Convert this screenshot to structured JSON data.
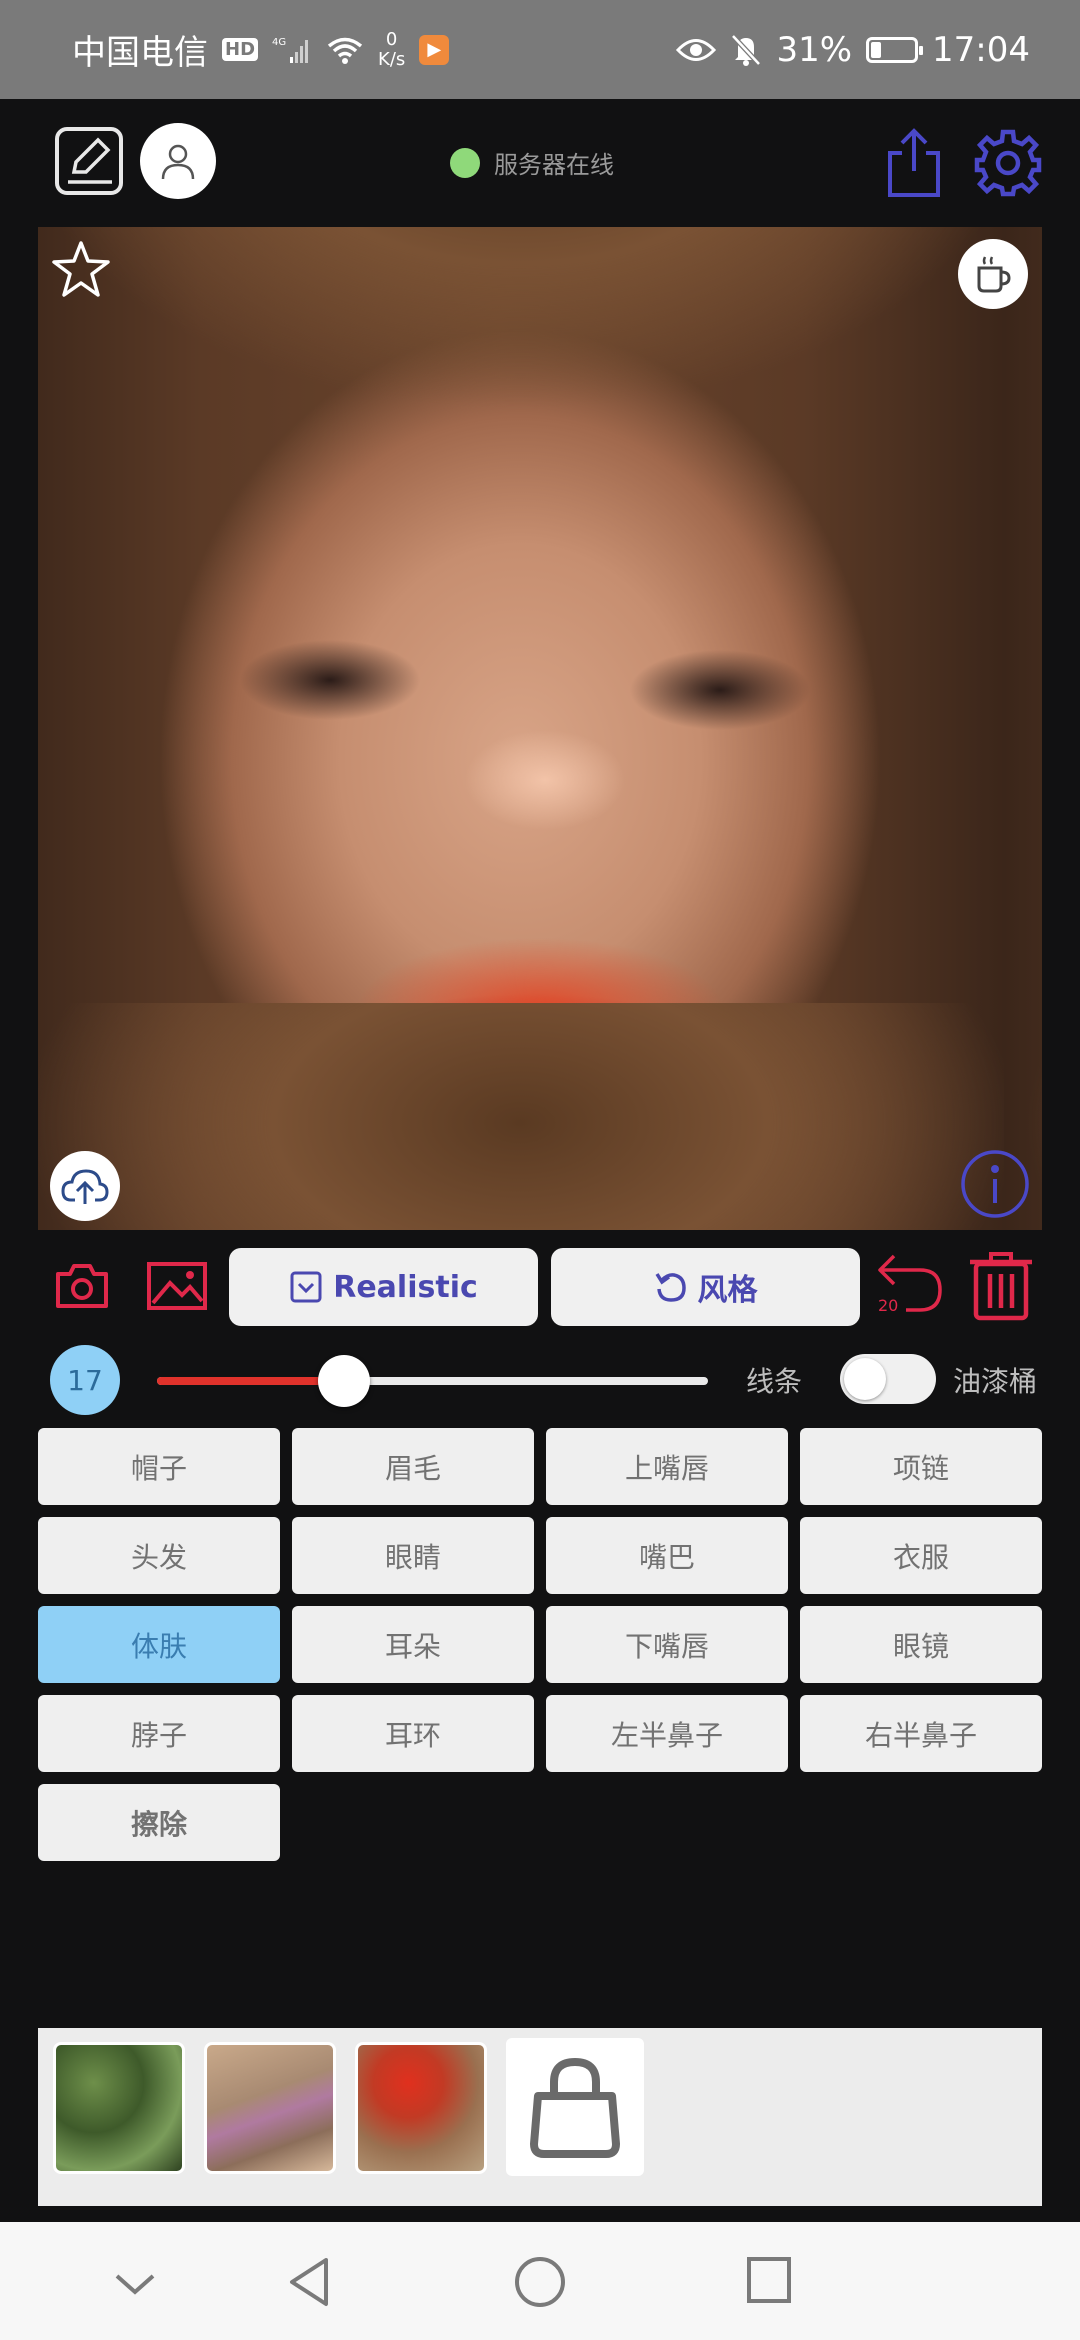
{
  "status_bar": {
    "carrier": "中国电信",
    "hd": "HD",
    "network": "4G",
    "speed_value": "0",
    "speed_unit": "K/s",
    "battery": "31%",
    "battery_level": 0.31,
    "time": "17:04"
  },
  "toolbar": {
    "server_status": "服务器在线",
    "server_dot_color": "#8fd97a",
    "accent": "#4a48c8"
  },
  "actions": {
    "realistic_label": "Realistic",
    "style_label": "风格",
    "undo_count": "20",
    "danger_color": "#e0284a"
  },
  "brush": {
    "size": "17",
    "slider_level": 0.34,
    "line_label": "线条",
    "bucket_label": "油漆桶",
    "bucket_on": false
  },
  "labels": [
    "帽子",
    "眉毛",
    "上嘴唇",
    "项链",
    "头发",
    "眼睛",
    "嘴巴",
    "衣服",
    "体肤",
    "耳朵",
    "下嘴唇",
    "眼镜",
    "脖子",
    "耳环",
    "左半鼻子",
    "右半鼻子",
    "擦除"
  ],
  "selected_label": "体肤",
  "style_thumbnails": [
    "green-foliage-texture",
    "stone-flower-texture",
    "red-flower-petals-texture"
  ],
  "store_icon": "shopping-bag-icon",
  "nav": [
    "collapse-icon",
    "back-icon",
    "home-icon",
    "recents-icon"
  ]
}
